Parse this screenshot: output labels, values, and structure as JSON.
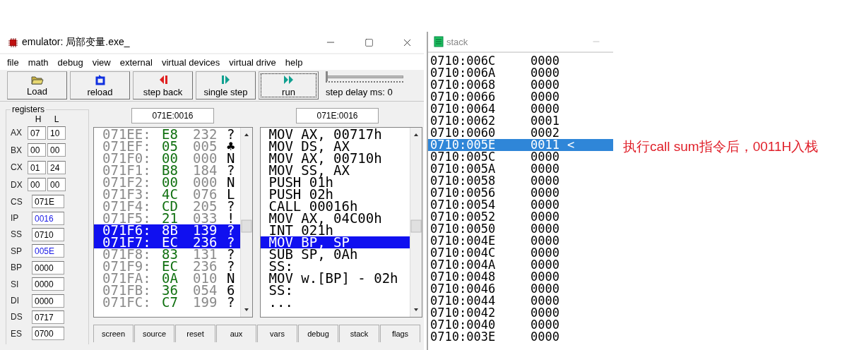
{
  "emulator": {
    "title": "emulator: 局部变量.exe_",
    "menu": [
      "file",
      "math",
      "debug",
      "view",
      "external",
      "virtual devices",
      "virtual drive",
      "help"
    ],
    "toolbar": [
      {
        "label": "Load",
        "kind": "load",
        "focused": false
      },
      {
        "label": "reload",
        "kind": "reload",
        "focused": false
      },
      {
        "label": "step back",
        "kind": "back",
        "focused": false
      },
      {
        "label": "single step",
        "kind": "step",
        "focused": false
      },
      {
        "label": "run",
        "kind": "run",
        "focused": true
      }
    ],
    "step_delay": {
      "label": "step delay ms: 0",
      "level": 0
    },
    "registers": {
      "title": "registers",
      "high_label": "H",
      "low_label": "L",
      "pairs": [
        {
          "name": "AX",
          "high": "07",
          "low": "10"
        },
        {
          "name": "BX",
          "high": "00",
          "low": "00"
        },
        {
          "name": "CX",
          "high": "01",
          "low": "24"
        },
        {
          "name": "DX",
          "high": "00",
          "low": "00"
        }
      ],
      "words": [
        {
          "name": "CS",
          "value": "071E",
          "changed": false
        },
        {
          "name": "IP",
          "value": "0016",
          "changed": true
        },
        {
          "name": "SS",
          "value": "0710",
          "changed": false
        },
        {
          "name": "SP",
          "value": "005E",
          "changed": true
        },
        {
          "name": "BP",
          "value": "0000",
          "changed": false
        },
        {
          "name": "SI",
          "value": "0000",
          "changed": false
        },
        {
          "name": "DI",
          "value": "0000",
          "changed": false
        },
        {
          "name": "DS",
          "value": "0717",
          "changed": false
        },
        {
          "name": "ES",
          "value": "0700",
          "changed": false
        }
      ]
    },
    "memory": {
      "address": "071E:0016",
      "rows": [
        {
          "address": "071EE:",
          "hex": "E8",
          "dec": "232",
          "char": "?",
          "selected": false
        },
        {
          "address": "071EF:",
          "hex": "05",
          "dec": "005",
          "char": "♣",
          "selected": false
        },
        {
          "address": "071F0:",
          "hex": "00",
          "dec": "000",
          "char": "N",
          "selected": false
        },
        {
          "address": "071F1:",
          "hex": "B8",
          "dec": "184",
          "char": "?",
          "selected": false
        },
        {
          "address": "071F2:",
          "hex": "00",
          "dec": "000",
          "char": "N",
          "selected": false
        },
        {
          "address": "071F3:",
          "hex": "4C",
          "dec": "076",
          "char": "L",
          "selected": false
        },
        {
          "address": "071F4:",
          "hex": "CD",
          "dec": "205",
          "char": "?",
          "selected": false
        },
        {
          "address": "071F5:",
          "hex": "21",
          "dec": "033",
          "char": "!",
          "selected": false
        },
        {
          "address": "071F6:",
          "hex": "8B",
          "dec": "139",
          "char": "?",
          "selected": true
        },
        {
          "address": "071F7:",
          "hex": "EC",
          "dec": "236",
          "char": "?",
          "selected": true
        },
        {
          "address": "071F8:",
          "hex": "83",
          "dec": "131",
          "char": "?",
          "selected": false
        },
        {
          "address": "071F9:",
          "hex": "EC",
          "dec": "236",
          "char": "?",
          "selected": false
        },
        {
          "address": "071FA:",
          "hex": "0A",
          "dec": "010",
          "char": "N",
          "selected": false
        },
        {
          "address": "071FB:",
          "hex": "36",
          "dec": "054",
          "char": "6",
          "selected": false
        },
        {
          "address": "071FC:",
          "hex": "C7",
          "dec": "199",
          "char": "?",
          "selected": false
        }
      ]
    },
    "disassembly": {
      "address": "071E:0016",
      "rows": [
        {
          "text": "MOV AX, 00717h",
          "selected": false
        },
        {
          "text": "MOV DS, AX",
          "selected": false
        },
        {
          "text": "MOV AX, 00710h",
          "selected": false
        },
        {
          "text": "MOV SS, AX",
          "selected": false
        },
        {
          "text": "PUSH 01h",
          "selected": false
        },
        {
          "text": "PUSH 02h",
          "selected": false
        },
        {
          "text": "CALL 00016h",
          "selected": false
        },
        {
          "text": "MOV AX, 04C00h",
          "selected": false
        },
        {
          "text": "INT 021h",
          "selected": false
        },
        {
          "text": "MOV BP, SP",
          "selected": true
        },
        {
          "text": "SUB SP, 0Ah",
          "selected": false
        },
        {
          "text": "SS:",
          "selected": false
        },
        {
          "text": "MOV w.[BP] - 02h",
          "selected": false
        },
        {
          "text": "SS:",
          "selected": false
        },
        {
          "text": "...",
          "selected": false
        }
      ]
    },
    "tabs": [
      "screen",
      "source",
      "reset",
      "aux",
      "vars",
      "debug",
      "stack",
      "flags"
    ]
  },
  "stack": {
    "title": "stack",
    "rows": [
      {
        "address": "0710:006C",
        "value": "0000",
        "selected": false
      },
      {
        "address": "0710:006A",
        "value": "0000",
        "selected": false
      },
      {
        "address": "0710:0068",
        "value": "0000",
        "selected": false
      },
      {
        "address": "0710:0066",
        "value": "0000",
        "selected": false
      },
      {
        "address": "0710:0064",
        "value": "0000",
        "selected": false
      },
      {
        "address": "0710:0062",
        "value": "0001",
        "selected": false
      },
      {
        "address": "0710:0060",
        "value": "0002",
        "selected": false
      },
      {
        "address": "0710:005E",
        "value": "0011",
        "marker": "<",
        "selected": true
      },
      {
        "address": "0710:005C",
        "value": "0000",
        "selected": false
      },
      {
        "address": "0710:005A",
        "value": "0000",
        "selected": false
      },
      {
        "address": "0710:0058",
        "value": "0000",
        "selected": false
      },
      {
        "address": "0710:0056",
        "value": "0000",
        "selected": false
      },
      {
        "address": "0710:0054",
        "value": "0000",
        "selected": false
      },
      {
        "address": "0710:0052",
        "value": "0000",
        "selected": false
      },
      {
        "address": "0710:0050",
        "value": "0000",
        "selected": false
      },
      {
        "address": "0710:004E",
        "value": "0000",
        "selected": false
      },
      {
        "address": "0710:004C",
        "value": "0000",
        "selected": false
      },
      {
        "address": "0710:004A",
        "value": "0000",
        "selected": false
      },
      {
        "address": "0710:0048",
        "value": "0000",
        "selected": false
      },
      {
        "address": "0710:0046",
        "value": "0000",
        "selected": false
      },
      {
        "address": "0710:0044",
        "value": "0000",
        "selected": false
      },
      {
        "address": "0710:0042",
        "value": "0000",
        "selected": false
      },
      {
        "address": "0710:0040",
        "value": "0000",
        "selected": false
      },
      {
        "address": "0710:003E",
        "value": "0000",
        "selected": false
      }
    ]
  },
  "annotation": "执行call sum指令后，0011H入栈"
}
